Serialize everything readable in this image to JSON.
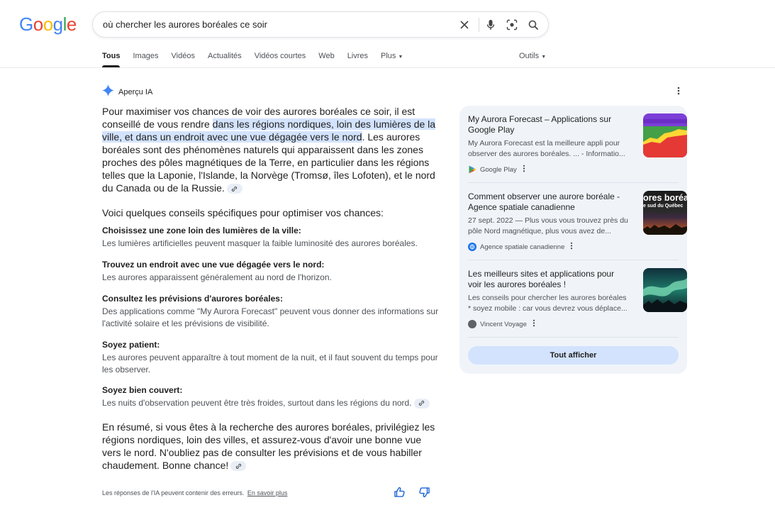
{
  "logo": {
    "letters": [
      "G",
      "o",
      "o",
      "g",
      "l",
      "e"
    ],
    "colors": [
      "#4285f4",
      "#ea4335",
      "#fbbc05",
      "#4285f4",
      "#34a853",
      "#ea4335"
    ]
  },
  "search": {
    "value": "où chercher les aurores boréales ce soir"
  },
  "tabs": [
    {
      "label": "Tous",
      "active": true
    },
    {
      "label": "Images"
    },
    {
      "label": "Vidéos"
    },
    {
      "label": "Actualités"
    },
    {
      "label": "Vidéos courtes"
    },
    {
      "label": "Web"
    },
    {
      "label": "Livres"
    },
    {
      "label": "Plus"
    }
  ],
  "tools_label": "Outils",
  "ai": {
    "title": "Aperçu IA",
    "para1_a": "Pour maximiser vos chances de voir des aurores boréales ce soir, il est conseillé de vous rendre ",
    "para1_hl": "dans les régions nordiques, loin des lumières de la ville, et dans un endroit avec une vue dégagée vers le nord",
    "para1_b": ". Les aurores boréales sont des phénomènes naturels qui apparaissent dans les zones proches des pôles magnétiques de la Terre, en particulier dans les régions telles que la Laponie, l'Islande, la Norvège (Tromsø, îles Lofoten), et le nord du Canada ou de la Russie.",
    "intro": "Voici quelques conseils spécifiques pour optimiser vos chances:",
    "tips": [
      {
        "title": "Choisissez une zone loin des lumières de la ville:",
        "desc": "Les lumières artificielles peuvent masquer la faible luminosité des aurores boréales."
      },
      {
        "title": "Trouvez un endroit avec une vue dégagée vers le nord:",
        "desc": "Les aurores apparaissent généralement au nord de l'horizon."
      },
      {
        "title": "Consultez les prévisions d'aurores boréales:",
        "desc": "Des applications comme \"My Aurora Forecast\" peuvent vous donner des informations sur l'activité solaire et les prévisions de visibilité."
      },
      {
        "title": "Soyez patient:",
        "desc": "Les aurores peuvent apparaître à tout moment de la nuit, et il faut souvent du temps pour les observer."
      },
      {
        "title": "Soyez bien couvert:",
        "desc": "Les nuits d'observation peuvent être très froides, surtout dans les régions du nord."
      }
    ],
    "summary": "En résumé, si vous êtes à la recherche des aurores boréales, privilégiez les régions nordiques, loin des villes, et assurez-vous d'avoir une bonne vue vers le nord. N'oubliez pas de consulter les prévisions et de vous habiller chaudement. Bonne chance!",
    "disclaimer": "Les réponses de l'IA peuvent contenir des erreurs.",
    "learn_more": "En savoir plus"
  },
  "sources": [
    {
      "title": "My Aurora Forecast – Applications sur Google Play",
      "snippet": "My Aurora Forecast est la meilleure appli pour observer des aurores boréales. ... - Informatio...",
      "site": "Google Play",
      "thumb_text": ""
    },
    {
      "title": "Comment observer une aurore boréale - Agence spatiale canadienne",
      "snippet": "27 sept. 2022 — Plus vous vous trouvez près du pôle Nord magnétique, plus vous avez de...",
      "site": "Agence spatiale canadienne",
      "thumb_text": "ores boréa",
      "thumb_sub": "e sud du Québec"
    },
    {
      "title": "Les meilleurs sites et applications pour voir les aurores boréales !",
      "snippet": "Les conseils pour chercher les aurores boréales * soyez mobile : car vous devrez vous déplace...",
      "site": "Vincent Voyage",
      "thumb_text": ""
    }
  ],
  "show_all": "Tout afficher"
}
